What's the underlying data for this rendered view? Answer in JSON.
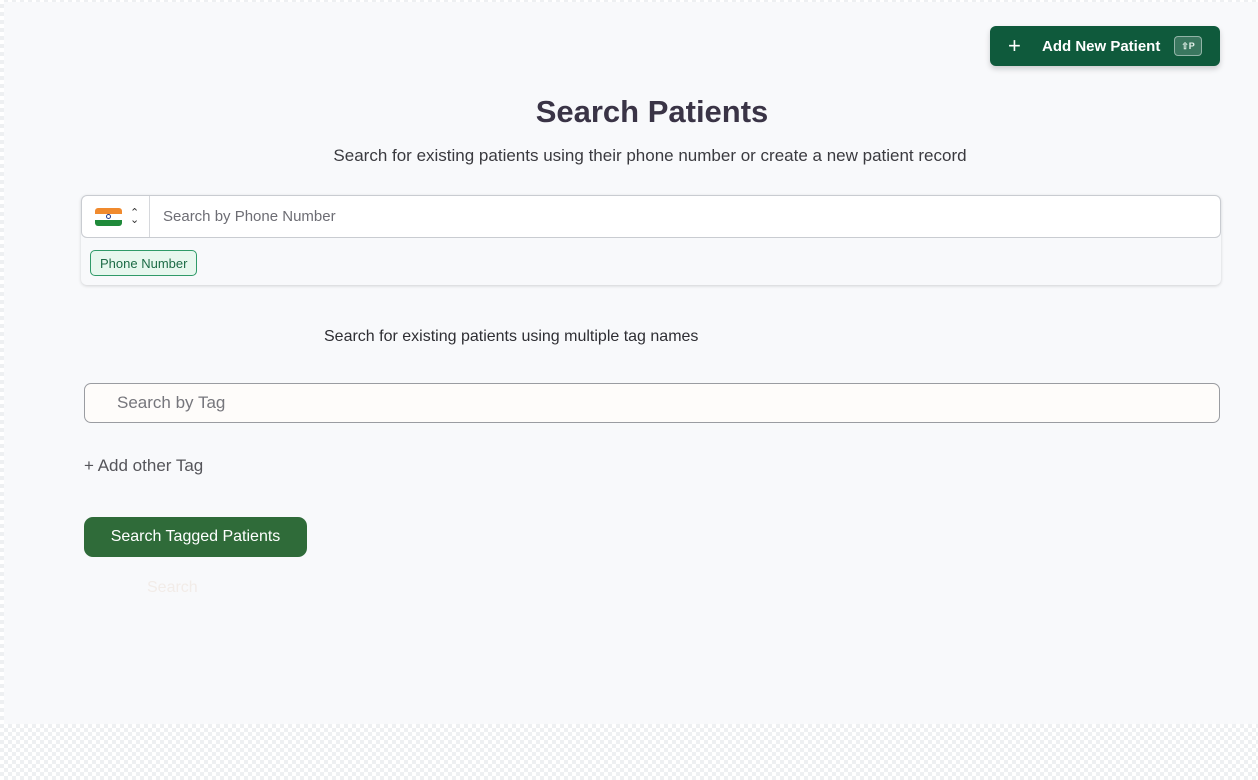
{
  "header": {
    "add_patient_label": "Add New Patient",
    "add_patient_shortcut": "⇧P"
  },
  "main": {
    "title": "Search Patients",
    "subtitle": "Search for existing patients using their phone number or create a new patient record"
  },
  "phone_search": {
    "country_flag": "india-flag-icon",
    "placeholder": "Search by Phone Number",
    "value": "",
    "chip_label": "Phone Number"
  },
  "tag_search": {
    "description": "Search for existing patients using multiple tag names",
    "placeholder": "Search by Tag",
    "value": "",
    "add_tag_label": "+ Add other Tag",
    "search_button_label": "Search Tagged Patients",
    "ghost_label": "Search"
  },
  "colors": {
    "primary_green": "#0f5a3c",
    "button_green": "#2f6b39",
    "chip_border": "#2f9a68",
    "chip_bg": "#e7f7ee"
  }
}
